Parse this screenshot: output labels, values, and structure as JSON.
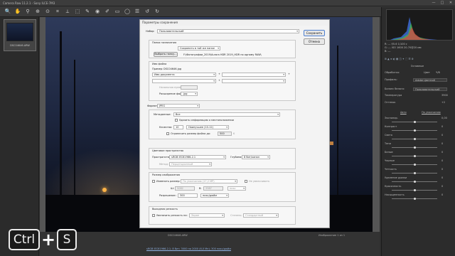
{
  "window": {
    "title": "Camera Raw 11.2.1 - Sony ILCE-7M3",
    "min": "—",
    "max": "□",
    "close": "✕"
  },
  "toolbar": {
    "tools": [
      "zoom-icon",
      "hand-icon",
      "white-balance-icon",
      "color-sampler-icon",
      "target-adjust-icon",
      "crop-icon",
      "straighten-icon",
      "transform-icon",
      "spot-removal-icon",
      "red-eye-icon",
      "adjustment-brush-icon",
      "graduated-filter-icon",
      "radial-filter-icon",
      "preferences-icon",
      "rotate-left-icon",
      "rotate-right-icon"
    ],
    "tool_glyphs": [
      "🔍",
      "✋",
      "⚲",
      "⊕",
      "⊙",
      "⌗",
      "⟂",
      "⬚",
      "✎",
      "◉",
      "✐",
      "▭",
      "◯",
      "☰",
      "↺",
      "↻"
    ],
    "right_glyphs": [
      "☐",
      "⇱"
    ]
  },
  "filmstrip": {
    "caption": "DSC04646.ARW"
  },
  "right_panel": {
    "readout_1": "R: ---   f/5.6   1/100 с",
    "readout_2": "G: ---   ISO 1600   20-70@20 мм",
    "readout_3": "B: ---",
    "tab_label": "Основные",
    "treatment": "Обработка:",
    "color": "Цвет",
    "bw": "Ч/б",
    "profile": "Профиль:",
    "profile_value": "Adobe Цветной",
    "wb": "Баланс белого:",
    "wb_value": "Пользовательский",
    "temp": "Температура",
    "temp_value": "3900",
    "tint": "Оттенок",
    "tint_value": "+2",
    "auto": "Авто",
    "default": "По умолчанию",
    "sliders": [
      {
        "label": "Экспонир.",
        "value": "0,00",
        "pos": 0.5
      },
      {
        "label": "Контраст",
        "value": "0",
        "pos": 0.5
      },
      {
        "label": "Света",
        "value": "0",
        "pos": 0.5
      },
      {
        "label": "Тени",
        "value": "0",
        "pos": 0.5
      },
      {
        "label": "Белые",
        "value": "0",
        "pos": 0.5
      },
      {
        "label": "Черные",
        "value": "0",
        "pos": 0.5
      },
      {
        "label": "Четкость",
        "value": "0",
        "pos": 0.5
      },
      {
        "label": "Удаление дымки",
        "value": "0",
        "pos": 0.5
      },
      {
        "label": "Красочность",
        "value": "0",
        "pos": 0.5
      },
      {
        "label": "Насыщенность",
        "value": "0",
        "pos": 0.5
      }
    ]
  },
  "status": {
    "filename": "DSC04646.ARW",
    "info": "sRGB IEC61966-2.1; 8 бит; 3000 на 2000 (6,0 Мп); 300 пикс/дюйм",
    "save_image": "Сохранить изображение...",
    "open_image": "Открыть изображение",
    "cancel": "Отмена",
    "done": "Готово",
    "zoom": "Изображение 1 из 1"
  },
  "dialog": {
    "title": "Параметры сохранения",
    "preset_label": "Набор:",
    "preset_value": "Пользовательский",
    "save_button": "Сохранить",
    "cancel_button": "Отмена",
    "dest_group": "Папка назначения",
    "dest_label": "Сохранить в той же папке",
    "choose_folder": "Выбрать папку...",
    "folder_path": "F:\\Фотографии_2019\\Aurora HDR 2019_HDR по одному RAW\\",
    "naming_group": "Имя файла",
    "example_label": "Пример:",
    "example_value": "DSC04646.jpg",
    "name_field_1": "Имя документа",
    "name_field_2": "",
    "plus": "+",
    "begin_number": "Начальная нумерация:",
    "ext_label": "Расширение файла:",
    "ext_value": ".jpg",
    "format_label": "Формат:",
    "format_value": "JPEG",
    "metadata_label": "Метаданные:",
    "metadata_value": "Все",
    "remove_location": "Удалить информацию о местоположении",
    "quality_label": "Качество:",
    "quality_value": "10",
    "quality_desc": "Наилучшее (10-12)",
    "limit_size": "Ограничить размер файла до:",
    "limit_value": "500",
    "limit_unit": "K",
    "color_group": "Цветовое пространство",
    "space_label": "Пространство:",
    "space_value": "sRGB IEC61966-2.1",
    "depth_label": "Глубина:",
    "depth_value": "8 бит/канал",
    "intent_label": "Метод:",
    "intent_value": "Перцепционный",
    "size_group": "Размер изображения",
    "resize_label": "Изменить размер:",
    "resize_value": "По умолчанию (17,2 МР)",
    "no_enlarge": "Не увеличивать",
    "w_label": "Ш:",
    "w_value": "5082",
    "h_label": "В:",
    "h_value": "3387",
    "px_unit": "пикс",
    "res_label": "Разрешение:",
    "res_value": "300",
    "res_unit": "пикс/дюйм",
    "sharp_group": "Выходная резкость",
    "sharp_label": "Увеличить резкость на:",
    "sharp_value": "Экран",
    "amount_label": "Степень:",
    "amount_value": "Стандартный"
  },
  "keys": {
    "ctrl": "Ctrl",
    "plus": "+",
    "s": "S"
  }
}
